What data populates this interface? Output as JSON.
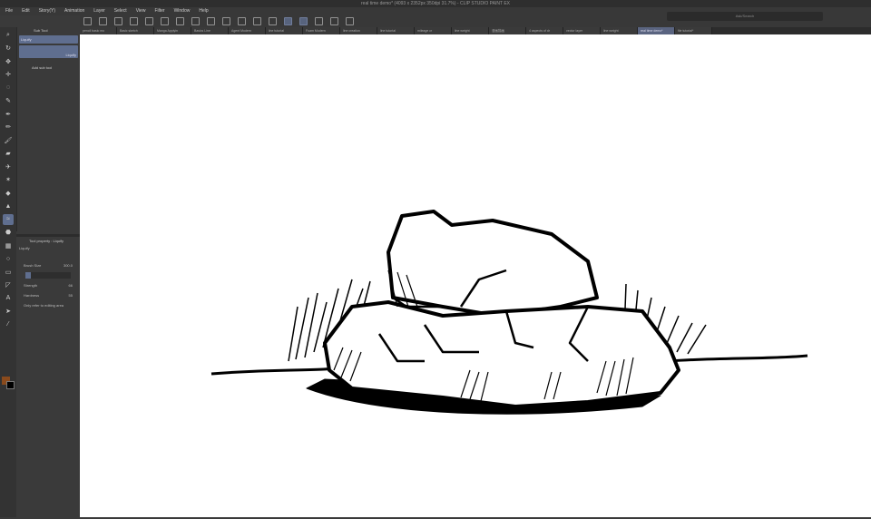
{
  "title": "real time demo* (4093 x 2352px 350dpi 31.7%) - CLIP STUDIO PAINT EX",
  "menu": [
    "File",
    "Edit",
    "Story(Y)",
    "Animation",
    "Layer",
    "Select",
    "View",
    "Filter",
    "Window",
    "Help"
  ],
  "search_placeholder": "Ask/Search",
  "tabs": [
    "pencil basic mo",
    "Basic sketch",
    "Manga Applyin",
    "Basics Line",
    "Agent Modern",
    "line tutorial",
    "Foam Modern",
    "line creation",
    "line tutorial",
    "mileage cr",
    "line weight",
    "漫画描画",
    "4 aspects of dr",
    "vector layer",
    "line weight",
    "real time demo*",
    "file tutorial*"
  ],
  "active_tab": 15,
  "subtool": {
    "header": "Sub Tool",
    "items": [
      "Liquify"
    ],
    "preset_badge": "Liquify",
    "add_label": "Add sub tool"
  },
  "tool_property": {
    "header": "Tool property : Liquify",
    "name": "Liquify",
    "brush_size_label": "Brush Size",
    "brush_size": "300.0",
    "strength_label": "Strength",
    "strength": "66",
    "hardness_label": "Hardness",
    "hardness": "55",
    "refer_label": "Only refer to editing area"
  },
  "colors": {
    "main": "#8a4a1c",
    "sub": "#000000",
    "accent": "#5f6e8f"
  }
}
